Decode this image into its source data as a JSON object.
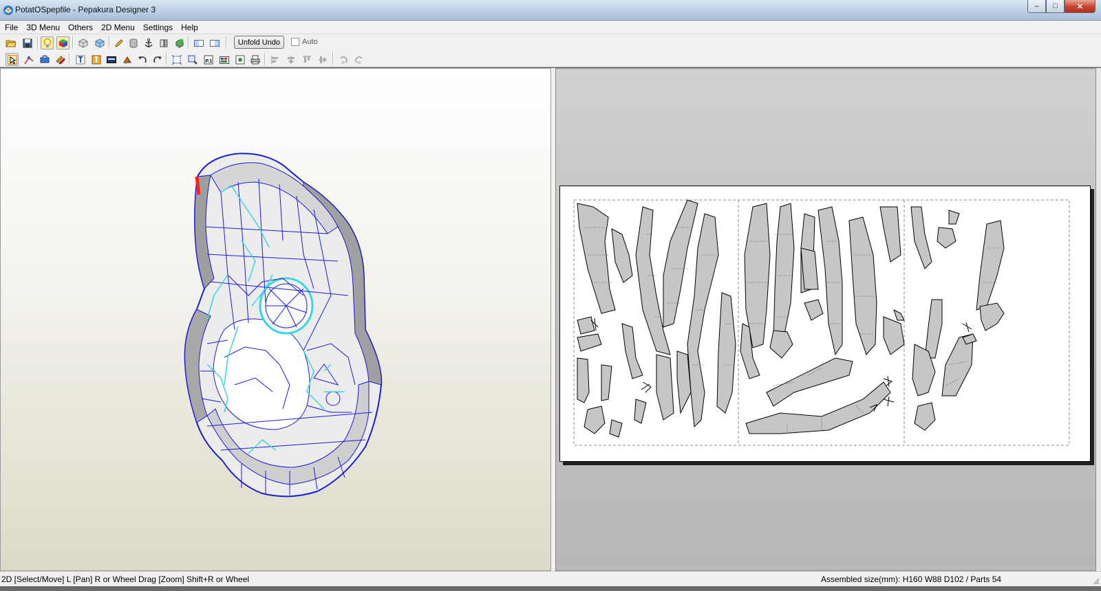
{
  "window": {
    "title": "PotatOSpepfile - Pepakura Designer 3",
    "minimize": "–",
    "maximize": "□",
    "close": "✕"
  },
  "menu": [
    "File",
    "3D Menu",
    "Others",
    "2D Menu",
    "Settings",
    "Help"
  ],
  "toolbar": {
    "unfold_undo": "Unfold Undo",
    "auto_label": "Auto",
    "auto_checked": false,
    "row1_icons": [
      "open-folder-icon",
      "save-icon",
      "lightbulb-icon",
      "color-cube-icon",
      "cube-outline-icon",
      "cube-shaded-icon",
      "pencil-icon",
      "cylinder-icon",
      "anchor-icon",
      "cut-edge-icon",
      "join-icon",
      "split-view-left-icon",
      "split-view-right-icon"
    ],
    "row2_icons": [
      "select-arrow-icon",
      "edit-line-icon",
      "flap-icon",
      "move-parts-icon",
      "text-icon",
      "image-icon",
      "rotate-part-icon",
      "undo-icon",
      "redo-icon",
      "fit-page-icon",
      "zoom-select-icon",
      "page-number-icon",
      "print-layout-icon",
      "picture-icon",
      "print-icon",
      "align-left-icon",
      "align-center-icon",
      "align-top-icon",
      "align-middle-icon",
      "rotate-90-left-icon",
      "rotate-90-right-icon"
    ]
  },
  "status": {
    "left": "2D [Select/Move] L [Pan] R or Wheel Drag [Zoom] Shift+R or Wheel",
    "right": "Assembled size(mm): H160 W88 D102 / Parts 54"
  },
  "colors": {
    "mesh_edge": "#1a1ad8",
    "fold_line": "#3ad6e0",
    "selected_edge": "#ff2020",
    "part_fill": "#c6c6c6"
  }
}
